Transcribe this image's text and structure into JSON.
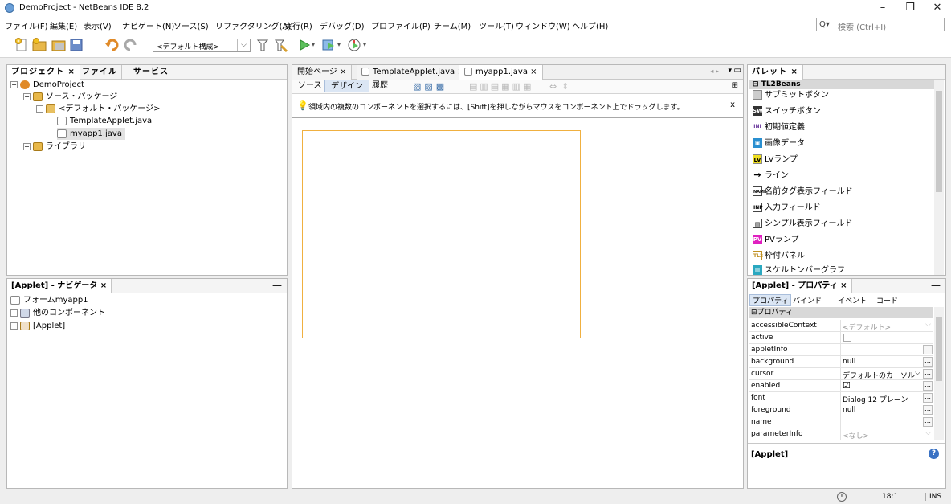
{
  "window": {
    "title": "DemoProject - NetBeans IDE 8.2",
    "minimize": "–",
    "maximize": "❐",
    "close": "✕"
  },
  "menu": [
    "ファイル(F)",
    "編集(E)",
    "表示(V)",
    "ナビゲート(N)",
    "ソース(S)",
    "リファクタリング(A)",
    "実行(R)",
    "デバッグ(D)",
    "プロファイル(P)",
    "チーム(M)",
    "ツール(T)",
    "ウィンドウ(W)",
    "ヘルプ(H)"
  ],
  "search": {
    "placeholder": "検索 (Ctrl+I)"
  },
  "toolbar": {
    "config": "<デフォルト構成>"
  },
  "projects_panel": {
    "tabs": [
      "プロジェクト ×",
      "ファイル",
      "サービス"
    ],
    "tree": [
      "DemoProject",
      "ソース・パッケージ",
      "<デフォルト・パッケージ>",
      "TemplateApplet.java",
      "myapp1.java",
      "ライブラリ"
    ]
  },
  "navigator_panel": {
    "title": "[Applet] - ナビゲータ ×",
    "tree": [
      "フォームmyapp1",
      "他のコンポーネント",
      "[Applet]"
    ]
  },
  "editor": {
    "tabs": [
      "開始ページ ×",
      "TemplateApplet.java ×",
      "myapp1.java ×"
    ],
    "subtabs": [
      "ソース",
      "デザイン",
      "履歴"
    ],
    "hint": "領域内の複数のコンポーネントを選択するには、[Shift]を押しながらマウスをコンポーネント上でドラッグします。",
    "hint_close": "x"
  },
  "palette": {
    "title": "パレット ×",
    "category": "TL2Beans",
    "items": [
      {
        "label": "サブミットボタン",
        "icon": "▬"
      },
      {
        "label": "スイッチボタン",
        "icon": "SW"
      },
      {
        "label": "初期値定義",
        "icon": "INI"
      },
      {
        "label": "画像データ",
        "icon": "▣"
      },
      {
        "label": "LVランプ",
        "icon": "LV"
      },
      {
        "label": "ライン",
        "icon": "→"
      },
      {
        "label": "名前タグ表示フィールド",
        "icon": "NAME"
      },
      {
        "label": "入力フィールド",
        "icon": "INP"
      },
      {
        "label": "シンプル表示フィールド",
        "icon": "▤"
      },
      {
        "label": "PVランプ",
        "icon": "PV"
      },
      {
        "label": "枠付パネル",
        "icon": "TL2"
      },
      {
        "label": "スケルトンバーグラフ",
        "icon": "▥"
      }
    ]
  },
  "properties": {
    "title": "[Applet] - プロパティ ×",
    "tabs": [
      "プロパティ",
      "バインド",
      "イベント",
      "コード"
    ],
    "section": "プロパティ",
    "rows": [
      {
        "name": "accessibleContext",
        "value": "<デフォルト>"
      },
      {
        "name": "active",
        "value": ""
      },
      {
        "name": "appletInfo",
        "value": ""
      },
      {
        "name": "background",
        "value": "null"
      },
      {
        "name": "cursor",
        "value": "デフォルトのカーソル"
      },
      {
        "name": "enabled",
        "value": "☑"
      },
      {
        "name": "font",
        "value": "Dialog 12 プレーン"
      },
      {
        "name": "foreground",
        "value": "null"
      },
      {
        "name": "name",
        "value": ""
      },
      {
        "name": "parameterInfo",
        "value": "<なし>"
      }
    ],
    "footer": "[Applet]"
  },
  "status": {
    "position": "18:1",
    "mode": "INS"
  }
}
